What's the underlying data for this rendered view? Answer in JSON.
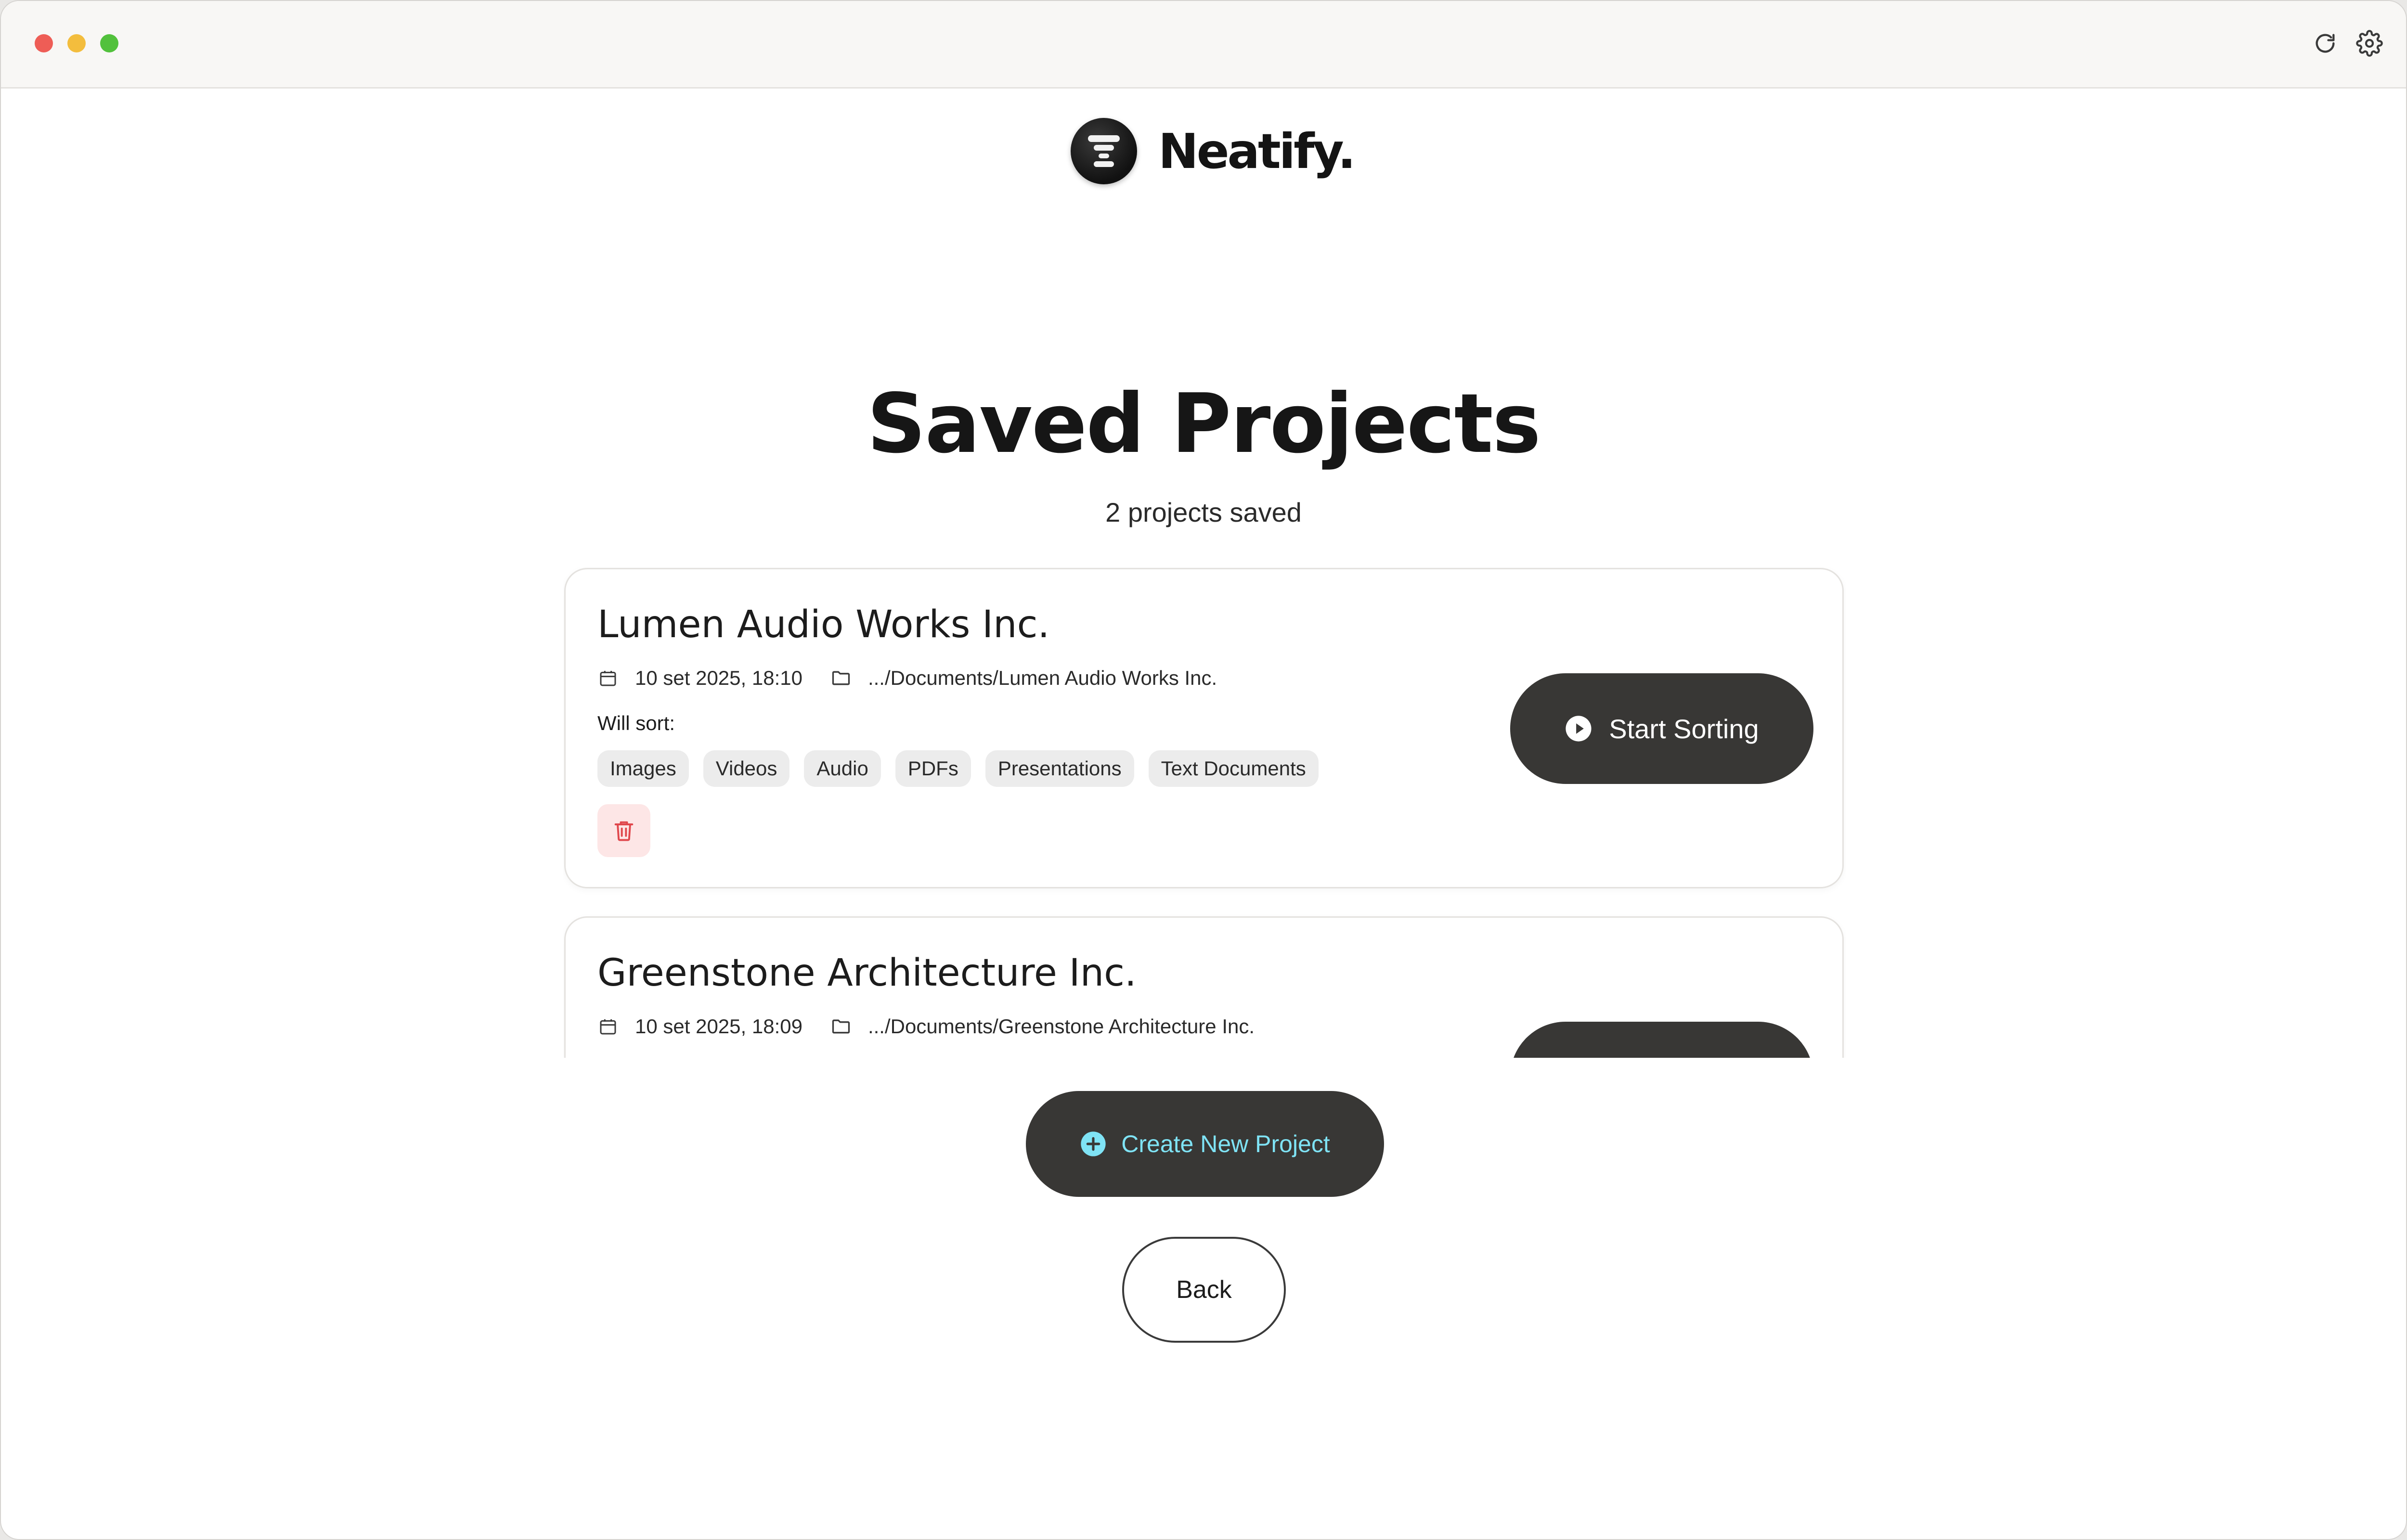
{
  "window": {
    "controls": [
      "close",
      "minimize",
      "zoom"
    ],
    "toolbar_icons": [
      "refresh-icon",
      "gear-icon"
    ]
  },
  "brand": {
    "name": "Neatify.",
    "logo_icon": "stacked-bars-logo-icon"
  },
  "page": {
    "title": "Saved Projects",
    "subtitle": "2 projects saved"
  },
  "projects": [
    {
      "name": "Lumen Audio Works Inc.",
      "date": "10 set 2025, 18:10",
      "path": ".../Documents/Lumen Audio Works Inc.",
      "will_sort_label": "Will sort:",
      "categories": [
        "Images",
        "Videos",
        "Audio",
        "PDFs",
        "Presentations",
        "Text Documents"
      ],
      "start_label": "Start Sorting"
    },
    {
      "name": "Greenstone Architecture Inc.",
      "date": "10 set 2025, 18:09",
      "path": ".../Documents/Greenstone Architecture Inc."
    }
  ],
  "actions": {
    "create_label": "Create New Project",
    "back_label": "Back"
  },
  "colors": {
    "dark_button": "#383735",
    "create_text": "#7fe3f5",
    "delete_bg": "#fde6e6",
    "delete_icon": "#e0474c",
    "traffic_close": "#ee5d56",
    "traffic_minimize": "#f3bd3d",
    "traffic_zoom": "#52c13c"
  }
}
